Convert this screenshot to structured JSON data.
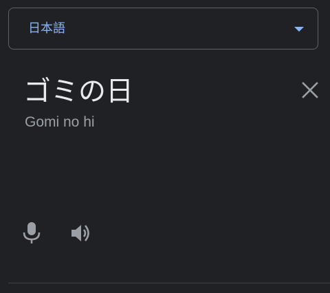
{
  "language_selector": {
    "selected": "日本語",
    "icon": "dropdown-arrow-icon",
    "accent_color": "#8ab4f8"
  },
  "source": {
    "text": "ゴミの日",
    "romanization": "Gomi no hi"
  },
  "actions": {
    "clear_icon": "close-icon",
    "microphone_icon": "microphone-icon",
    "listen_icon": "speaker-icon"
  },
  "colors": {
    "background": "#202124",
    "text_primary": "#e8eaed",
    "text_secondary": "#9aa0a6",
    "icon": "#9aa0a6"
  }
}
